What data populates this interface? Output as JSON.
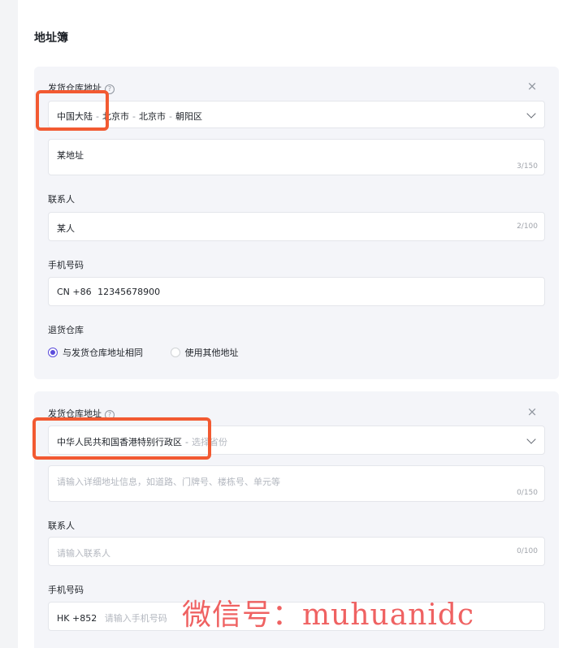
{
  "page_title": "地址簿",
  "cards": [
    {
      "warehouse_label": "发货仓库地址",
      "region": {
        "country": "中国大陆",
        "sep": "-",
        "province": "北京市",
        "city": "北京市",
        "district": "朝阳区"
      },
      "address": {
        "value": "某地址",
        "count": "3/150"
      },
      "contact_label": "联系人",
      "contact": {
        "value": "某人",
        "count": "2/100"
      },
      "phone_label": "手机号码",
      "phone": {
        "prefix": "CN +86",
        "value": "12345678900"
      },
      "return_label": "退货仓库",
      "return_options": [
        "与发货仓库地址相同",
        "使用其他地址"
      ]
    },
    {
      "warehouse_label": "发货仓库地址",
      "region": {
        "country": "中华人民共和国香港特别行政区",
        "sep": "-",
        "placeholder": "选择省份"
      },
      "address": {
        "placeholder": "请输入详细地址信息，如道路、门牌号、楼栋号、单元等",
        "count": "0/150"
      },
      "contact_label": "联系人",
      "contact": {
        "placeholder": "请输入联系人",
        "count": "0/100"
      },
      "phone_label": "手机号码",
      "phone": {
        "prefix": "HK +852",
        "placeholder": "请输入手机号码"
      }
    }
  ],
  "watermark": "微信号：muhuanidc",
  "colors": {
    "highlight": "#f25a32",
    "accent": "#5b4cdb",
    "card_bg": "#f4f5f9"
  }
}
